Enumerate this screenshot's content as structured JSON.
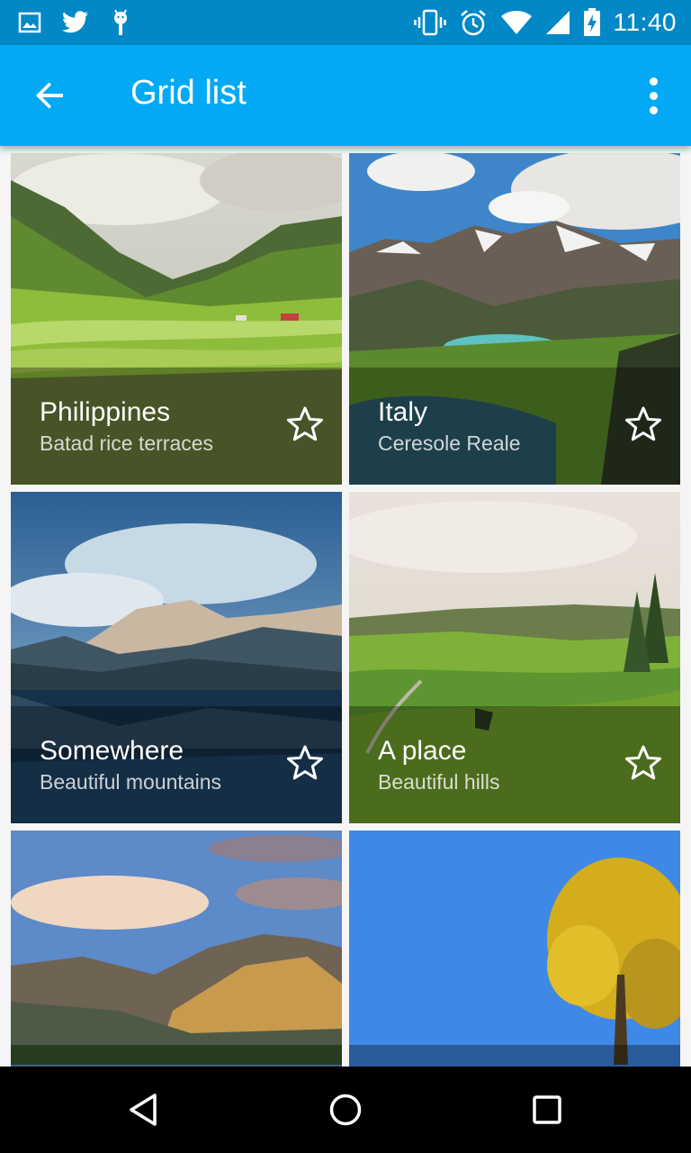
{
  "status_bar": {
    "time": "11:40",
    "icons": [
      "image-icon",
      "twitter-icon",
      "android-debug-icon",
      "vibrate-icon",
      "alarm-icon",
      "wifi-icon",
      "signal-icon",
      "battery-icon"
    ]
  },
  "app_bar": {
    "title": "Grid list",
    "back_icon": "arrow-back-icon",
    "menu_icon": "more-vert-icon"
  },
  "colors": {
    "status_bar": "#0288c7",
    "app_bar": "#03a9f4"
  },
  "tiles": [
    {
      "title": "Philippines",
      "subtitle": "Batad rice terraces",
      "favorite_icon": "star-outline-icon"
    },
    {
      "title": "Italy",
      "subtitle": "Ceresole Reale",
      "favorite_icon": "star-outline-icon"
    },
    {
      "title": "Somewhere",
      "subtitle": "Beautiful mountains",
      "favorite_icon": "star-outline-icon"
    },
    {
      "title": "A place",
      "subtitle": "Beautiful hills",
      "favorite_icon": "star-outline-icon"
    },
    {
      "title": "",
      "subtitle": "",
      "favorite_icon": ""
    },
    {
      "title": "",
      "subtitle": "",
      "favorite_icon": ""
    }
  ],
  "nav_bar": {
    "icons": [
      "back-triangle-icon",
      "home-circle-icon",
      "recents-square-icon"
    ]
  }
}
